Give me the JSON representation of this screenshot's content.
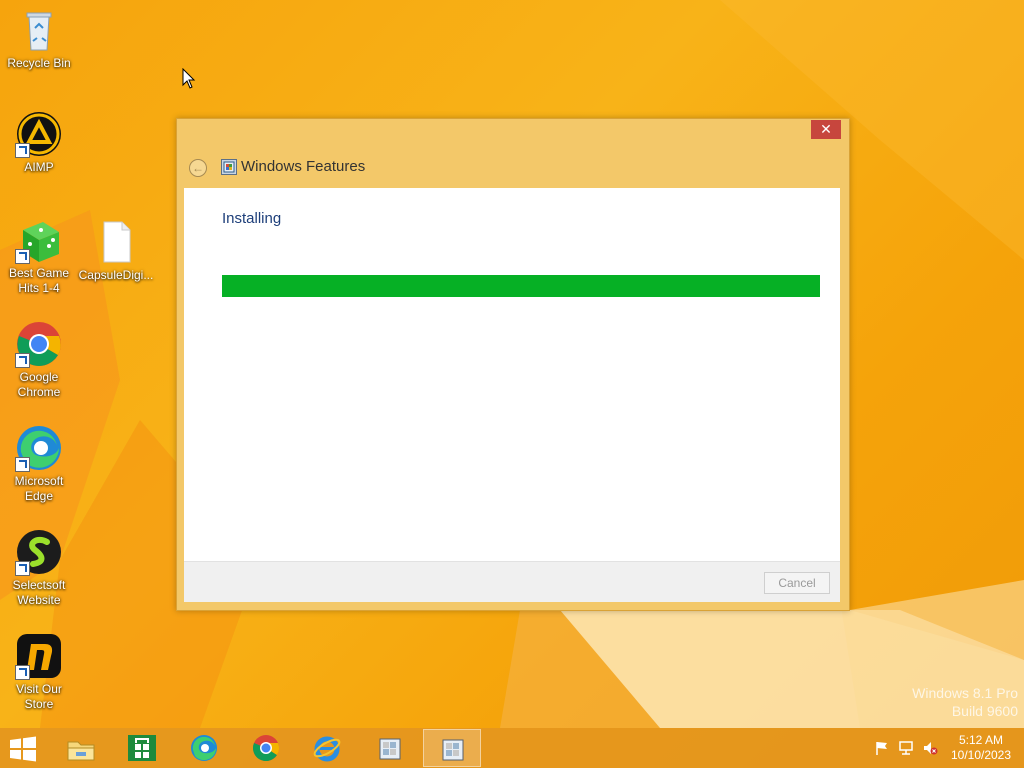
{
  "desktop": {
    "icons": [
      {
        "label": "Recycle Bin",
        "icon": "recycle-bin-icon"
      },
      {
        "label": "AIMP",
        "icon": "aimp-icon"
      },
      {
        "label": "Best Game Hits 1-4",
        "icon": "dice-icon"
      },
      {
        "label": "CapsuleDigi...",
        "icon": "file-icon"
      },
      {
        "label": "Google Chrome",
        "icon": "chrome-icon"
      },
      {
        "label": "Microsoft Edge",
        "icon": "edge-icon"
      },
      {
        "label": "Selectsoft Website",
        "icon": "selectsoft-icon"
      },
      {
        "label": "Visit Our Store",
        "icon": "store-icon"
      }
    ],
    "watermark": {
      "line1": "Windows 8.1 Pro",
      "line2": "Build 9600"
    }
  },
  "window": {
    "title": "Windows Features",
    "close_glyph": "✕",
    "back_glyph": "←",
    "status_label": "Installing",
    "progress": 1.0,
    "progress_color": "#06b025",
    "cancel_label": "Cancel"
  },
  "taskbar": {
    "buttons": [
      {
        "name": "file-explorer",
        "icon": "folder-icon",
        "active": false
      },
      {
        "name": "store",
        "icon": "windows-store-icon",
        "active": false
      },
      {
        "name": "edge",
        "icon": "edge-icon",
        "active": false
      },
      {
        "name": "chrome",
        "icon": "chrome-icon",
        "active": false
      },
      {
        "name": "internet-explorer",
        "icon": "ie-icon",
        "active": false
      },
      {
        "name": "features-1",
        "icon": "windows-features-icon",
        "active": false
      },
      {
        "name": "features-2",
        "icon": "windows-features-icon",
        "active": true
      }
    ],
    "time": "5:12 AM",
    "date": "10/10/2023"
  },
  "colors": {
    "accent": "#f5a30a",
    "close_red": "#c7463d"
  }
}
